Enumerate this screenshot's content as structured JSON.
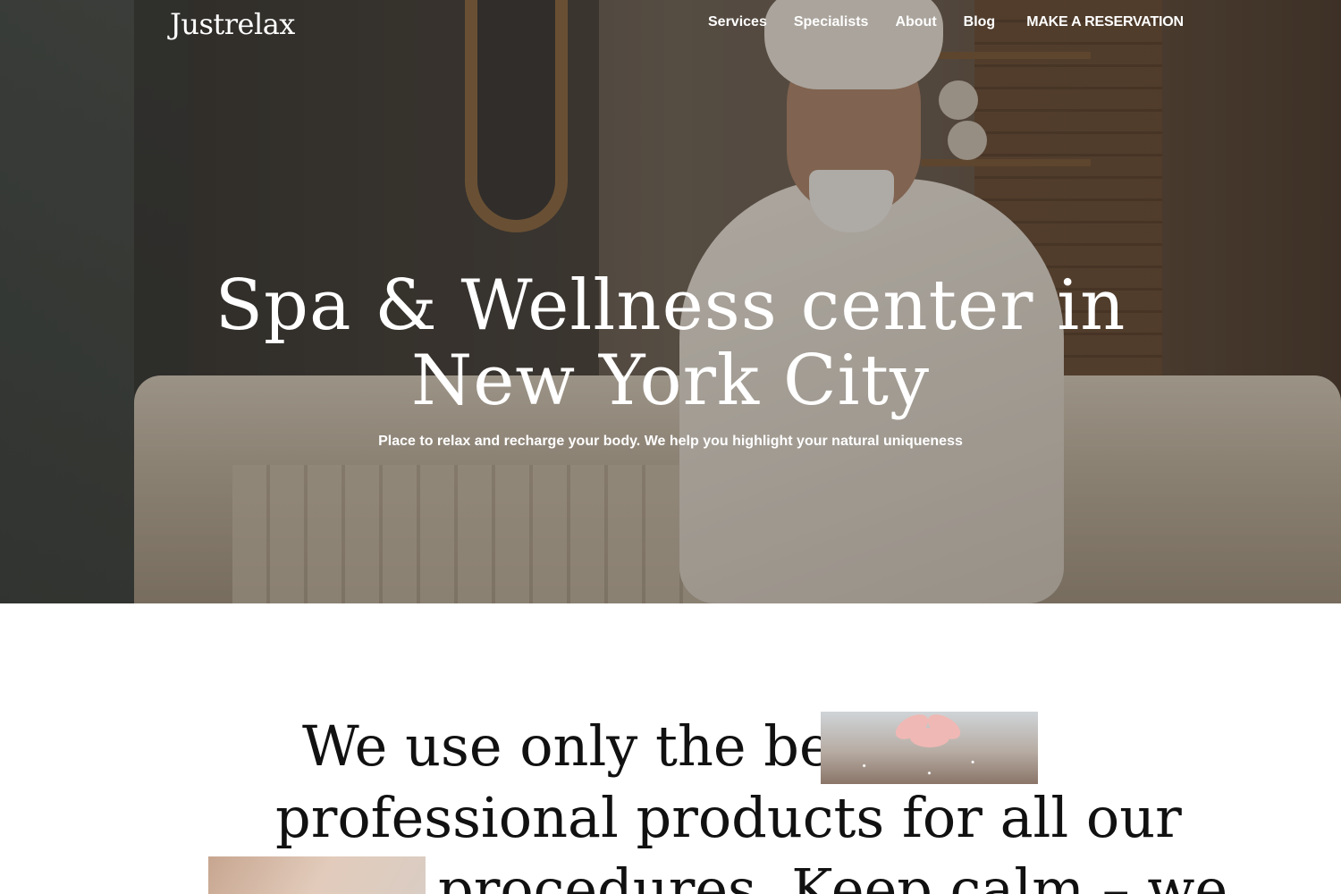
{
  "brand": {
    "logo": "Justrelax"
  },
  "nav": {
    "items": [
      "Services",
      "Specialists",
      "About",
      "Blog"
    ],
    "cta": "MAKE A RESERVATION"
  },
  "hero": {
    "title_line1": "Spa & Wellness center in",
    "title_line2": "New York City",
    "subtitle": "Place to relax and recharge your body. We help you highlight your natural uniqueness"
  },
  "statement": {
    "line1": "We use only the best",
    "line2": "professional products for all our",
    "line3": "procedures. Keep calm – we"
  },
  "colors": {
    "text_dark": "#111111",
    "hero_text": "#ffffff"
  }
}
